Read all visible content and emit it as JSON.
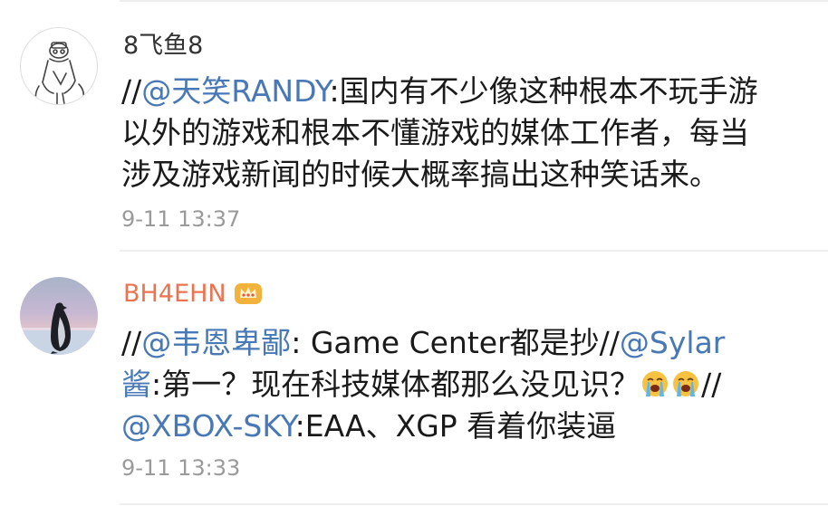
{
  "comments": [
    {
      "username": "8飞鱼8",
      "lines": [
        {
          "prefix": "//",
          "mention": "@天笑RANDY",
          "text": ":国内有不少像这种根本不玩手游"
        },
        {
          "text": "以外的游戏和根本不懂游戏的媒体工作者，每当"
        },
        {
          "text": "涉及游戏新闻的时候大概率搞出这种笑话来。"
        }
      ],
      "time": "9-11 13:37"
    },
    {
      "username": "BH4EHN",
      "lines": [
        {
          "prefix": "//",
          "mention": "@韦恩卑鄙",
          "text": ": Game Center都是抄",
          "suffix": "//",
          "mention2": "@Sylar"
        },
        {
          "mention": "酱",
          "text": ":第一？现在科技媒体都那么没见识？",
          "suffix": "//"
        },
        {
          "mention": "@XBOX-SKY",
          "text": ":EAA、XGP 看着你装逼"
        }
      ],
      "time": "9-11 13:33"
    }
  ],
  "colors": {
    "mention": "#4878b6",
    "username_plain": "#333333",
    "username_vip": "#eb7350",
    "timestamp": "#9a9a9a"
  },
  "icons": {
    "avatar1": "cartoon-sketch-avatar",
    "avatar2": "penguin-photo-avatar",
    "badge": "crown-badge-icon",
    "emoji": "crying-emoji-icon"
  }
}
